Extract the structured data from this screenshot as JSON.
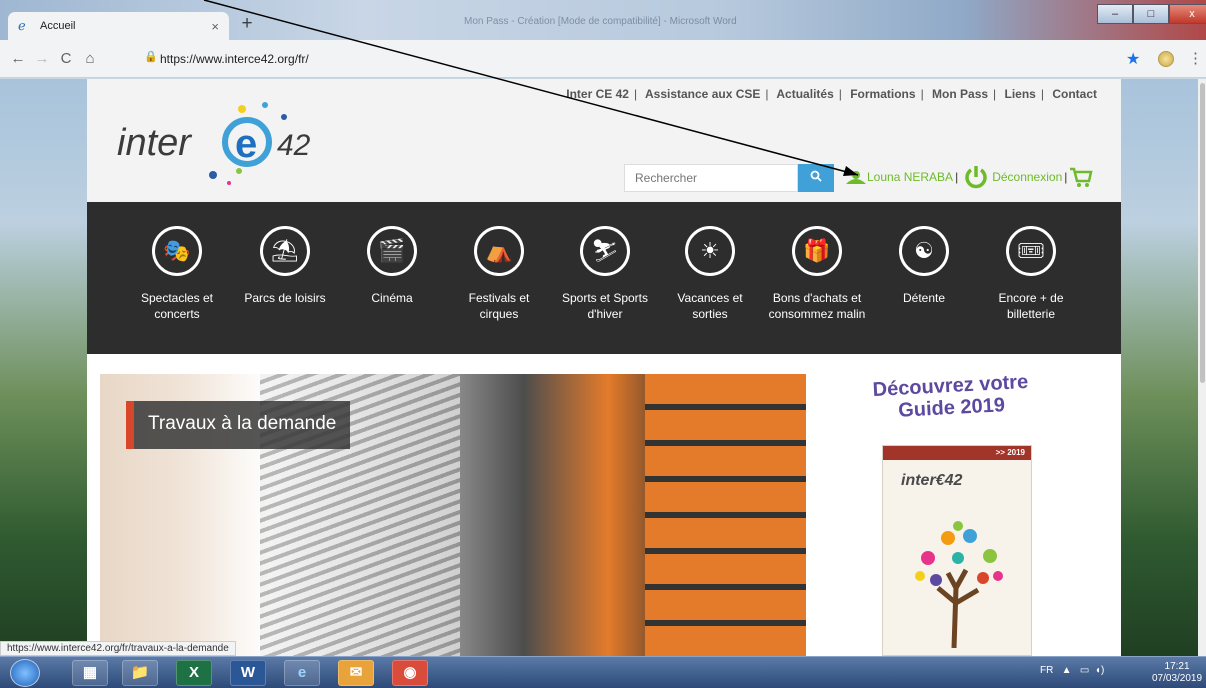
{
  "browser": {
    "tab_title": "Accueil",
    "new_tab_symbol": "+",
    "tab_close_symbol": "×",
    "window_title": "Mon Pass - Création [Mode de compatibilité] - Microsoft Word",
    "url": "https://www.interce42.org/fr/",
    "status_url": "https://www.interce42.org/fr/travaux-a-la-demande"
  },
  "site": {
    "logo_text": "inter",
    "logo_ce": "e",
    "logo_42": "42",
    "top_nav": [
      "Inter CE 42",
      "Assistance aux CSE",
      "Actualités",
      "Formations",
      "Mon Pass",
      "Liens",
      "Contact"
    ],
    "search_placeholder": "Rechercher",
    "user_name": "Louna NERABA",
    "logout_label": "Déconnexion",
    "categories": [
      {
        "label": "Spectacles et concerts",
        "icon": "theater-icon"
      },
      {
        "label": "Parcs de loisirs",
        "icon": "carousel-icon"
      },
      {
        "label": "Cinéma",
        "icon": "clapperboard-icon"
      },
      {
        "label": "Festivals et cirques",
        "icon": "circus-tent-icon"
      },
      {
        "label": "Sports et Sports d'hiver",
        "icon": "skier-icon"
      },
      {
        "label": "Vacances et sorties",
        "icon": "beach-icon"
      },
      {
        "label": "Bons d'achats et consommez malin",
        "icon": "gift-icon"
      },
      {
        "label": "Détente",
        "icon": "meditation-icon"
      },
      {
        "label": "Encore + de billetterie",
        "icon": "ticket-icon"
      }
    ],
    "hero_caption": "Travaux à la demande",
    "guide_heading": "Découvrez votre Guide 2019",
    "guide_band": ">> 2019",
    "guide_logo": "inter€42"
  },
  "taskbar": {
    "language": "FR",
    "time": "17:21",
    "date": "07/03/2019"
  }
}
